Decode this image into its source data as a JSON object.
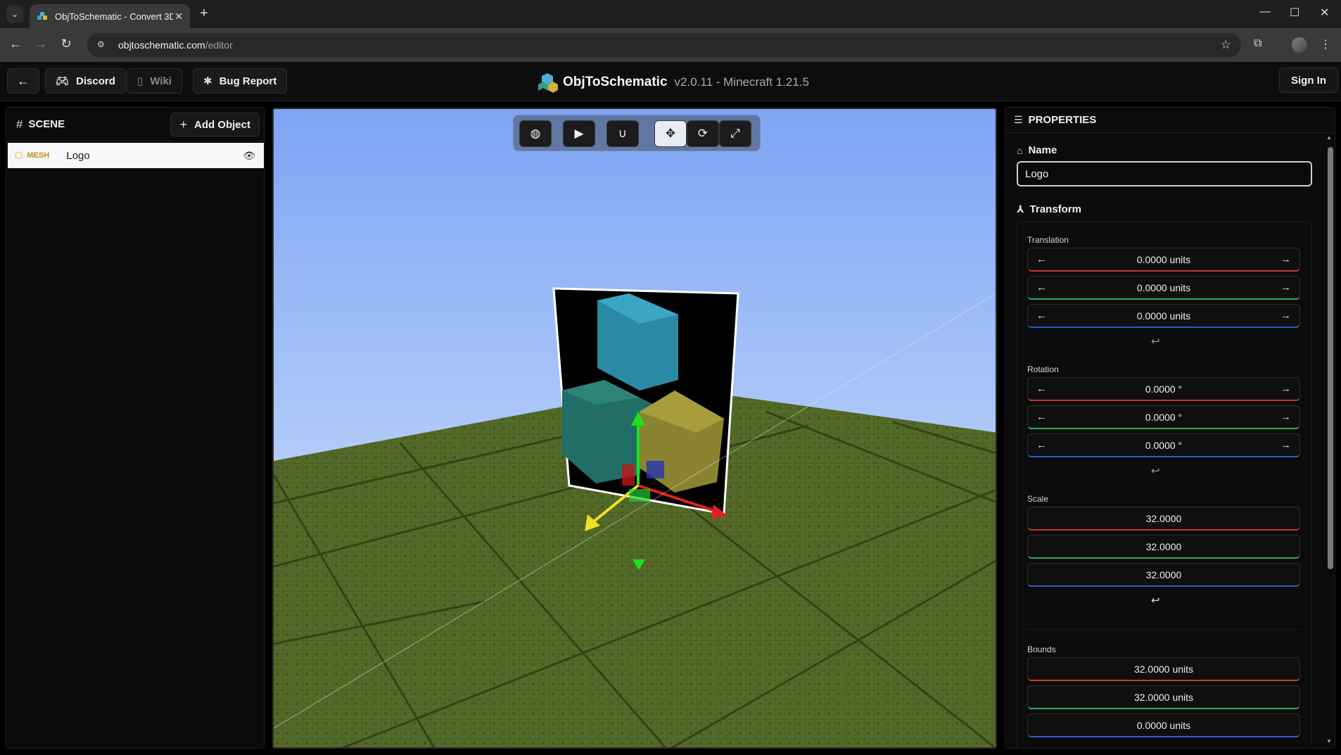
{
  "browser": {
    "tab_title": "ObjToSchematic - Convert 3D m",
    "url_host": "objtoschematic.com",
    "url_path": "/editor",
    "new_tab": "+",
    "close": "✕"
  },
  "header": {
    "discord": "Discord",
    "wiki": "Wiki",
    "bug_report": "Bug Report",
    "app_name": "ObjToSchematic",
    "version": "v2.0.11 - Minecraft 1.21.5",
    "sign_in": "Sign In"
  },
  "scene": {
    "title": "SCENE",
    "add_object": "Add Object",
    "objects": [
      {
        "type": "MESH",
        "name": "Logo"
      }
    ]
  },
  "viewport": {
    "tools": [
      "globe-icon",
      "camera-icon",
      "magnet-icon",
      "move-icon",
      "rotate-icon",
      "scale-icon"
    ],
    "active_tool": "move-icon"
  },
  "properties": {
    "title": "PROPERTIES",
    "name_label": "Name",
    "name_value": "Logo",
    "transform_label": "Transform",
    "translation_label": "Translation",
    "translation": [
      "0.0000 units",
      "0.0000 units",
      "0.0000 units"
    ],
    "rotation_label": "Rotation",
    "rotation": [
      "0.0000 °",
      "0.0000 °",
      "0.0000 °"
    ],
    "scale_label": "Scale",
    "scale": [
      "32.0000",
      "32.0000",
      "32.0000"
    ],
    "bounds_label": "Bounds",
    "bounds": [
      "32.0000 units",
      "32.0000 units",
      "0.0000 units"
    ]
  },
  "colors": {
    "x_axis": "#c0392b",
    "y_axis": "#27ae60",
    "z_axis": "#2e5cc7",
    "grass": "#4b5e25",
    "sky": "#9fbdf7"
  }
}
